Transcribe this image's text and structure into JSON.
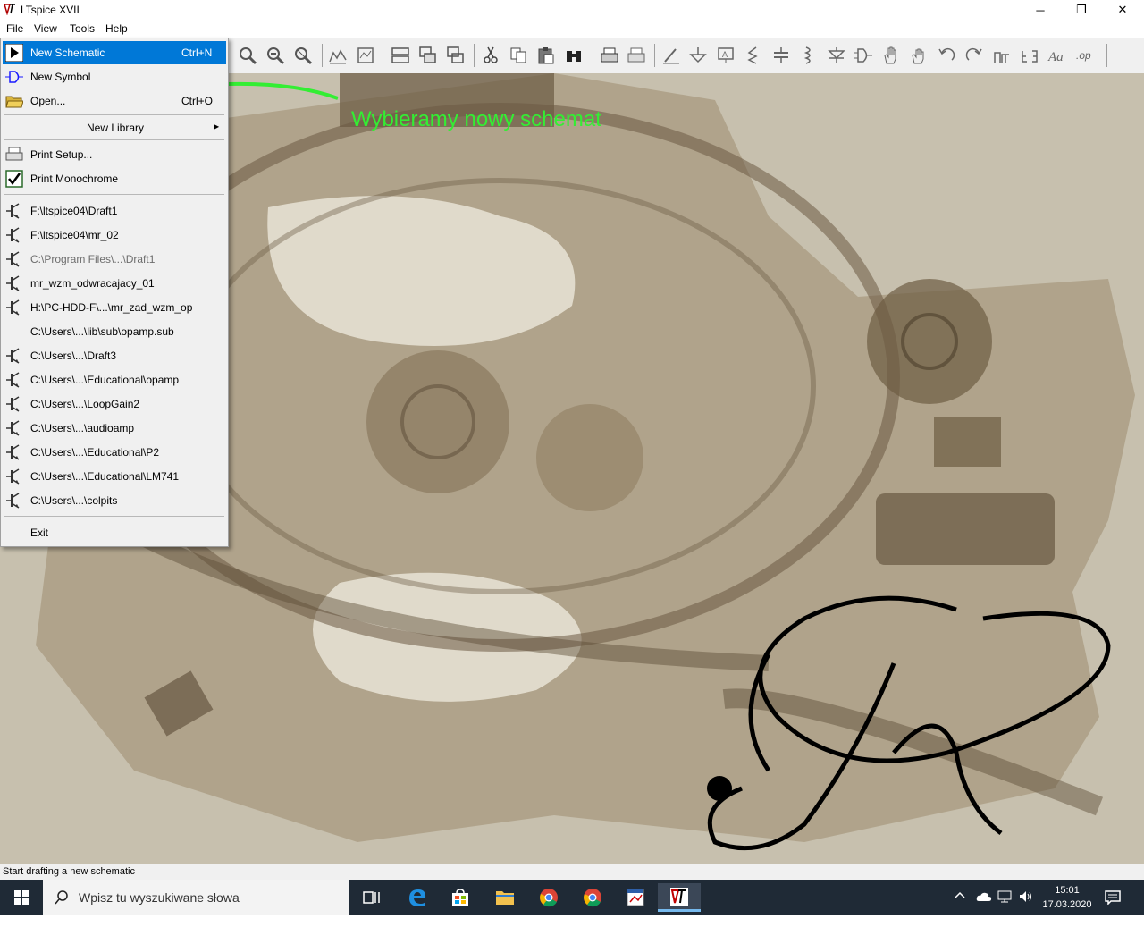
{
  "window": {
    "title": "LTspice XVII",
    "minimize": "─",
    "restore": "❐",
    "close": "✕"
  },
  "menubar": {
    "file": "File",
    "view": "View",
    "tools": "Tools",
    "help": "Help"
  },
  "file_menu": {
    "new_schematic": {
      "label": "New Schematic",
      "shortcut": "Ctrl+N"
    },
    "new_symbol": {
      "label": "New Symbol"
    },
    "open": {
      "label": "Open...",
      "shortcut": "Ctrl+O"
    },
    "new_library": {
      "label": "New Library",
      "arrow": "▶"
    },
    "print_setup": {
      "label": "Print Setup..."
    },
    "print_monochrome": {
      "label": "Print Monochrome",
      "checked": true
    },
    "recent_files": [
      {
        "label": "F:\\ltspice04\\Draft1",
        "enabled": true,
        "icon": "transistor-icon"
      },
      {
        "label": "F:\\ltspice04\\mr_02",
        "enabled": true,
        "icon": "transistor-icon"
      },
      {
        "label": "C:\\Program Files\\...\\Draft1",
        "enabled": false,
        "icon": "transistor-icon"
      },
      {
        "label": "mr_wzm_odwracajacy_01",
        "enabled": true,
        "icon": "transistor-icon"
      },
      {
        "label": "H:\\PC-HDD-F\\...\\mr_zad_wzm_op",
        "enabled": true,
        "icon": "transistor-icon"
      },
      {
        "label": "C:\\Users\\...\\lib\\sub\\opamp.sub",
        "enabled": true,
        "icon": "none"
      },
      {
        "label": "C:\\Users\\...\\Draft3",
        "enabled": true,
        "icon": "transistor-icon"
      },
      {
        "label": "C:\\Users\\...\\Educational\\opamp",
        "enabled": true,
        "icon": "transistor-icon"
      },
      {
        "label": "C:\\Users\\...\\LoopGain2",
        "enabled": true,
        "icon": "transistor-icon"
      },
      {
        "label": "C:\\Users\\...\\audioamp",
        "enabled": true,
        "icon": "transistor-icon"
      },
      {
        "label": "C:\\Users\\...\\Educational\\P2",
        "enabled": true,
        "icon": "transistor-icon"
      },
      {
        "label": "C:\\Users\\...\\Educational\\LM741",
        "enabled": true,
        "icon": "transistor-icon"
      },
      {
        "label": "C:\\Users\\...\\colpits",
        "enabled": true,
        "icon": "transistor-icon"
      }
    ],
    "exit": {
      "label": "Exit"
    }
  },
  "annotation": {
    "text": "Wybieramy nowy schemat",
    "color": "#33ee33"
  },
  "status": {
    "text": "Start drafting a new schematic"
  },
  "taskbar": {
    "search_placeholder": "Wpisz tu wyszukiwane słowa",
    "time": "15:01",
    "date": "17.03.2020"
  },
  "colors": {
    "highlight": "#0078d7",
    "canvas": "#c7c0ae",
    "taskbar": "#1f2a36"
  }
}
